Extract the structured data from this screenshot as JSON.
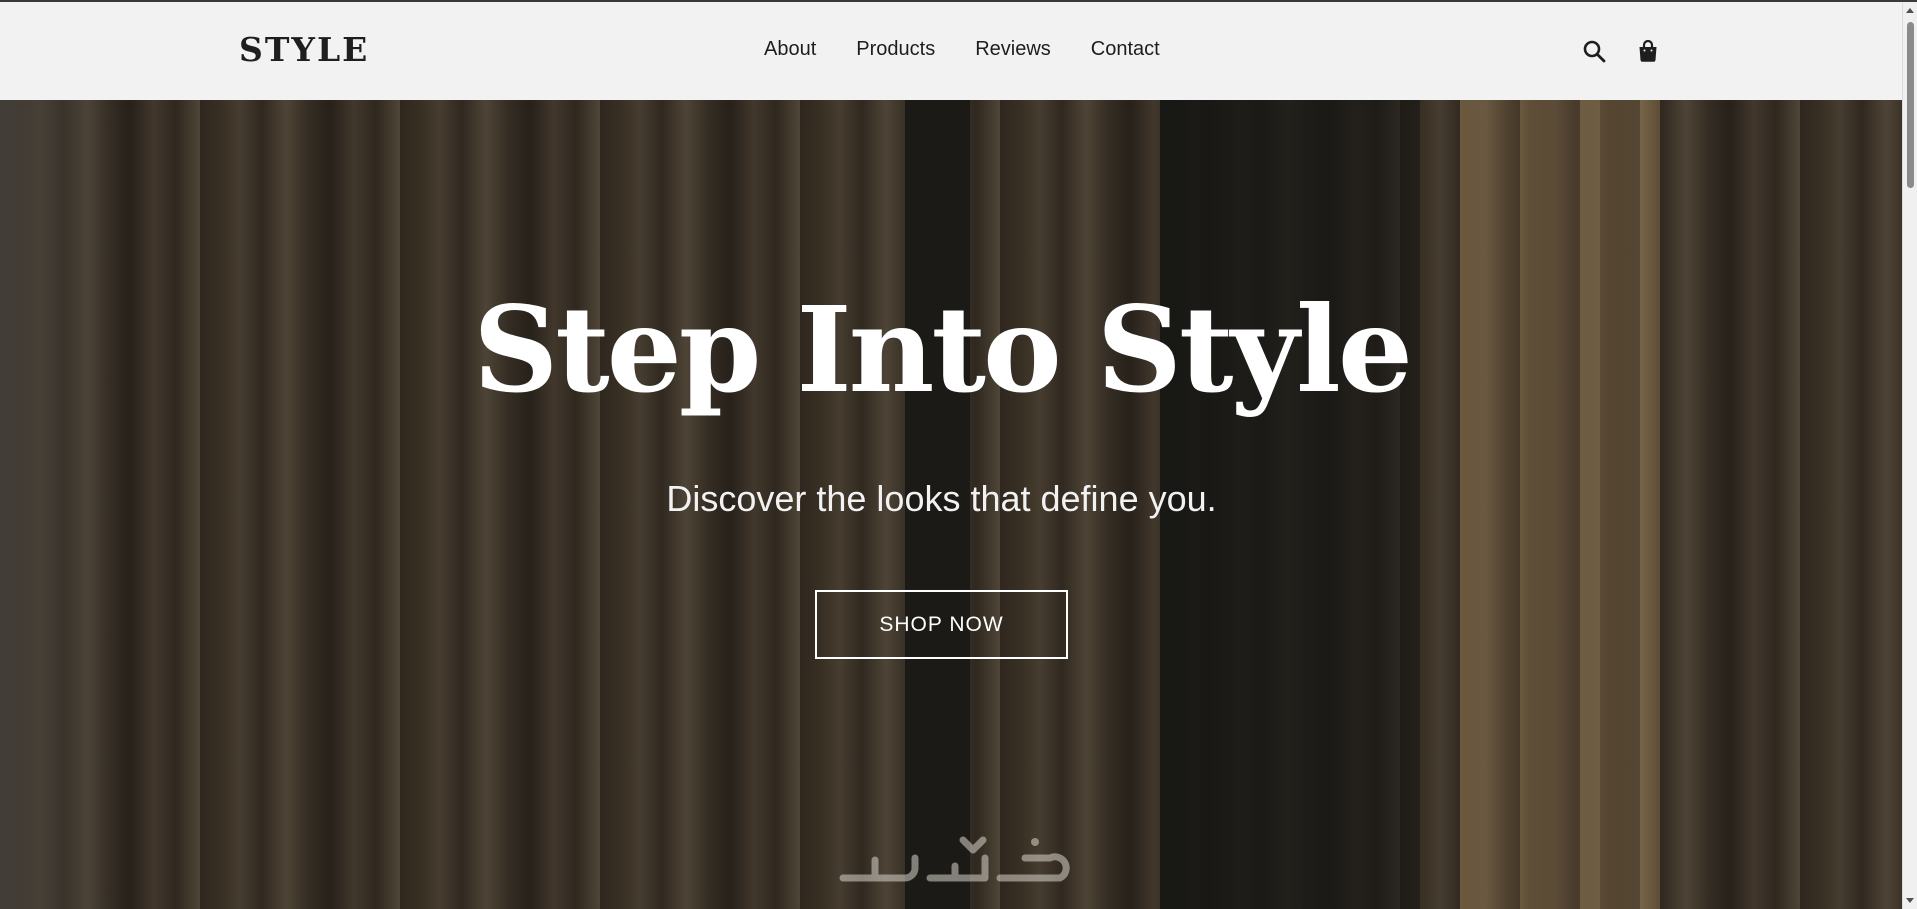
{
  "header": {
    "logo": "STYLE",
    "nav": [
      "About",
      "Products",
      "Reviews",
      "Contact"
    ],
    "icons": [
      "search-icon",
      "shopping-bag-icon"
    ]
  },
  "hero": {
    "title": "Step Into Style",
    "subtitle": "Discover the looks that define you.",
    "cta": "SHOP NOW",
    "watermark": "خمسات"
  },
  "colors": {
    "header_bg": "#f2f2f2",
    "text_dark": "#1e1e1e",
    "hero_text": "#ffffff"
  }
}
